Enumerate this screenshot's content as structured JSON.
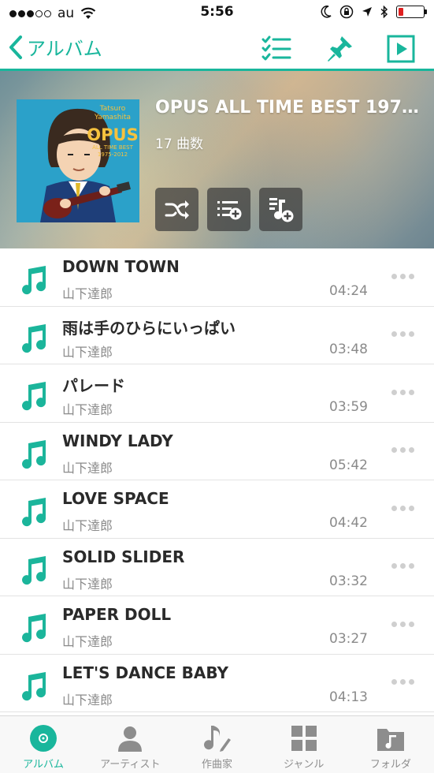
{
  "status_bar": {
    "carrier": "au",
    "time": "5:56",
    "battery_level": 0.2,
    "colors": {
      "battery_low": "#e02020"
    }
  },
  "nav": {
    "back_label": "アルバム",
    "accent_color": "#19b69c",
    "icons": [
      "checklist-icon",
      "pin-icon",
      "play-icon"
    ]
  },
  "album": {
    "title": "OPUS ALL TIME BEST 1975...",
    "track_count": "17 曲数",
    "cover": {
      "artist_name": "Tatsuro Yamashita",
      "title": "OPUS",
      "subtitle": "ALL TIME BEST",
      "years": "1975-2012"
    },
    "actions": [
      "shuffle-icon",
      "add-to-queue-icon",
      "add-to-playlist-icon"
    ]
  },
  "tracks": [
    {
      "title": "DOWN TOWN",
      "artist": "山下達郎",
      "duration": "04:24"
    },
    {
      "title": "雨は手のひらにいっぱい",
      "artist": "山下達郎",
      "duration": "03:48"
    },
    {
      "title": "パレード",
      "artist": "山下達郎",
      "duration": "03:59"
    },
    {
      "title": "WINDY LADY",
      "artist": "山下達郎",
      "duration": "05:42"
    },
    {
      "title": "LOVE SPACE",
      "artist": "山下達郎",
      "duration": "04:42"
    },
    {
      "title": "SOLID SLIDER",
      "artist": "山下達郎",
      "duration": "03:32"
    },
    {
      "title": "PAPER DOLL",
      "artist": "山下達郎",
      "duration": "03:27"
    },
    {
      "title": "LET'S DANCE BABY",
      "artist": "山下達郎",
      "duration": "04:13"
    }
  ],
  "tabs": [
    {
      "label": "アルバム",
      "icon": "album-icon",
      "active": true
    },
    {
      "label": "アーティスト",
      "icon": "artist-icon",
      "active": false
    },
    {
      "label": "作曲家",
      "icon": "composer-icon",
      "active": false
    },
    {
      "label": "ジャンル",
      "icon": "genre-icon",
      "active": false
    },
    {
      "label": "フォルダ",
      "icon": "folder-icon",
      "active": false
    }
  ]
}
